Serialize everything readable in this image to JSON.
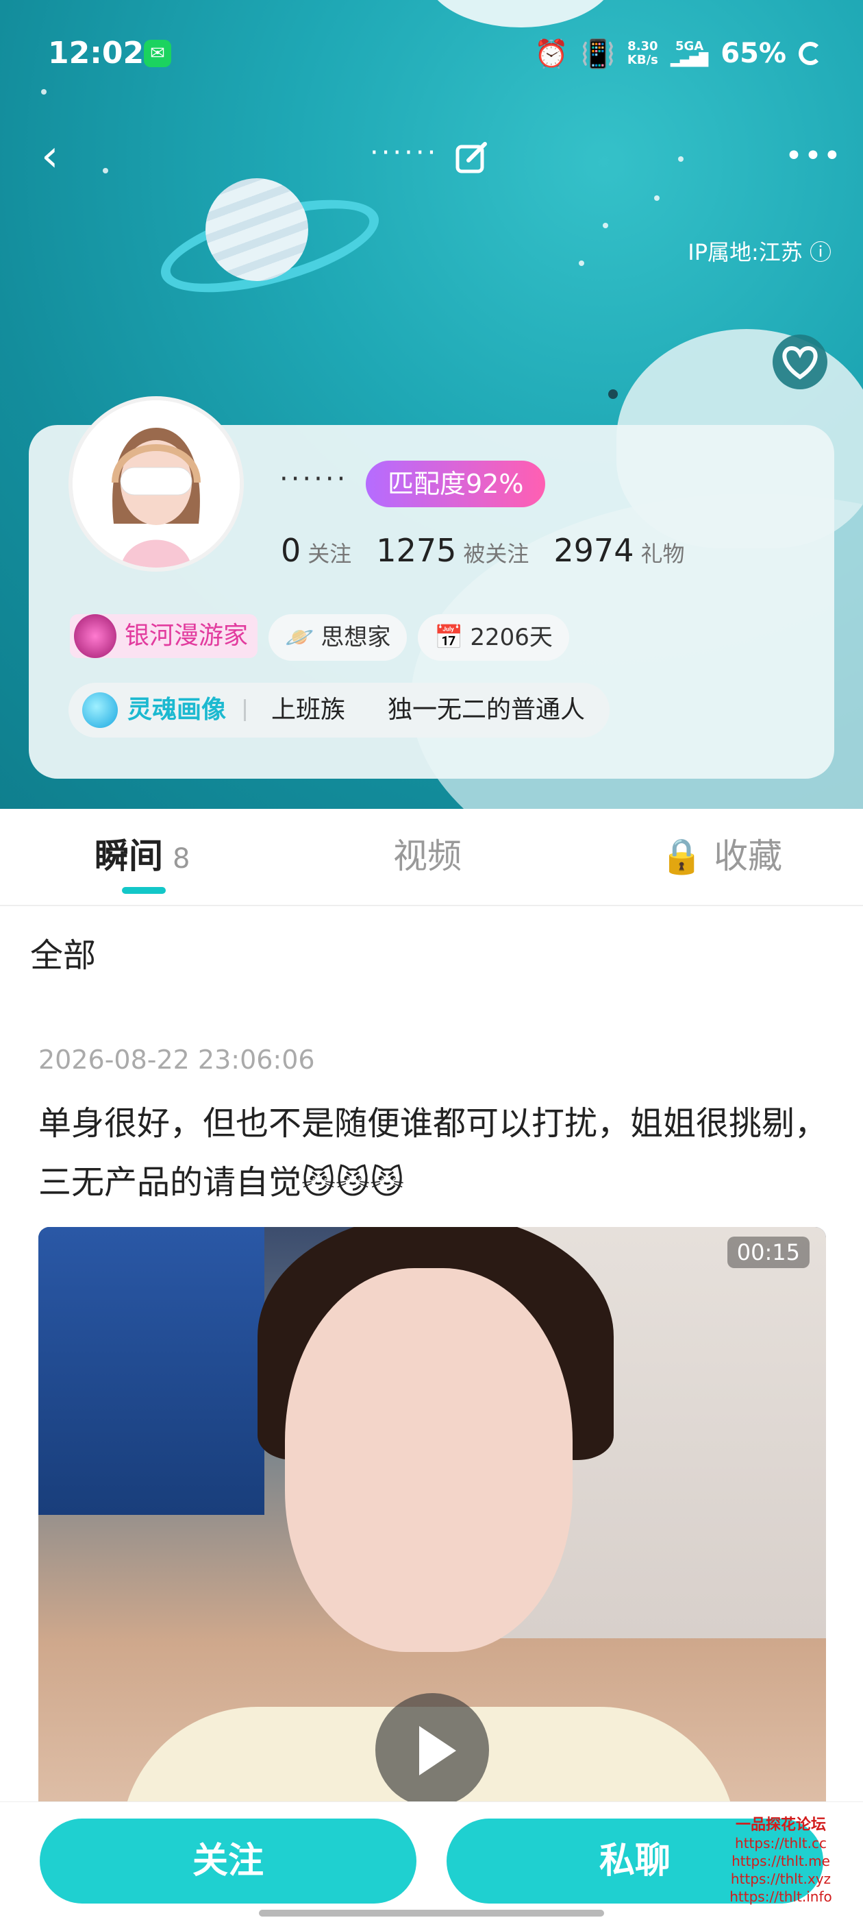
{
  "status_bar": {
    "time": "12:02",
    "net_speed_top": "8.30",
    "net_speed_unit": "KB/s",
    "network_type": "5GA",
    "battery": "65%"
  },
  "header": {
    "title_dots": "······",
    "more": "•••",
    "ip_location": "IP属地:江苏"
  },
  "profile": {
    "name_dots": "······",
    "match_label": "匹配度92%",
    "stats": [
      {
        "value": "0",
        "label": "关注"
      },
      {
        "value": "1275",
        "label": "被关注"
      },
      {
        "value": "2974",
        "label": "礼物"
      }
    ],
    "badge_galaxy": "银河漫游家",
    "chip_thinker": "思想家",
    "chip_days": "2206天",
    "soul_label": "灵魂画像",
    "soul_tags": [
      "上班族",
      "独一无二的普通人"
    ]
  },
  "tabs": [
    {
      "label": "瞬间",
      "count": "8"
    },
    {
      "label": "视频"
    },
    {
      "label": "收藏"
    }
  ],
  "filter_label": "全部",
  "post": {
    "timestamp": "2026-08-22 23:06:06",
    "text": "单身很好，但也不是随便谁都可以打扰，姐姐很挑剔，三无产品的请自觉😼😼😼",
    "video_duration": "00:15"
  },
  "bottom_bar": {
    "follow_label": "关注",
    "chat_label": "私聊"
  },
  "watermark": {
    "title": "一品探花论坛",
    "urls": [
      "https://thlt.cc",
      "https://thlt.me",
      "https://thlt.xyz",
      "https://thlt.info"
    ]
  },
  "colors": {
    "accent": "#1fd0d0",
    "match_gradient_start": "#b56cff",
    "match_gradient_end": "#ff5fb2",
    "galaxy_badge_text": "#e23b9e",
    "soul_label_text": "#1cb9d0"
  }
}
